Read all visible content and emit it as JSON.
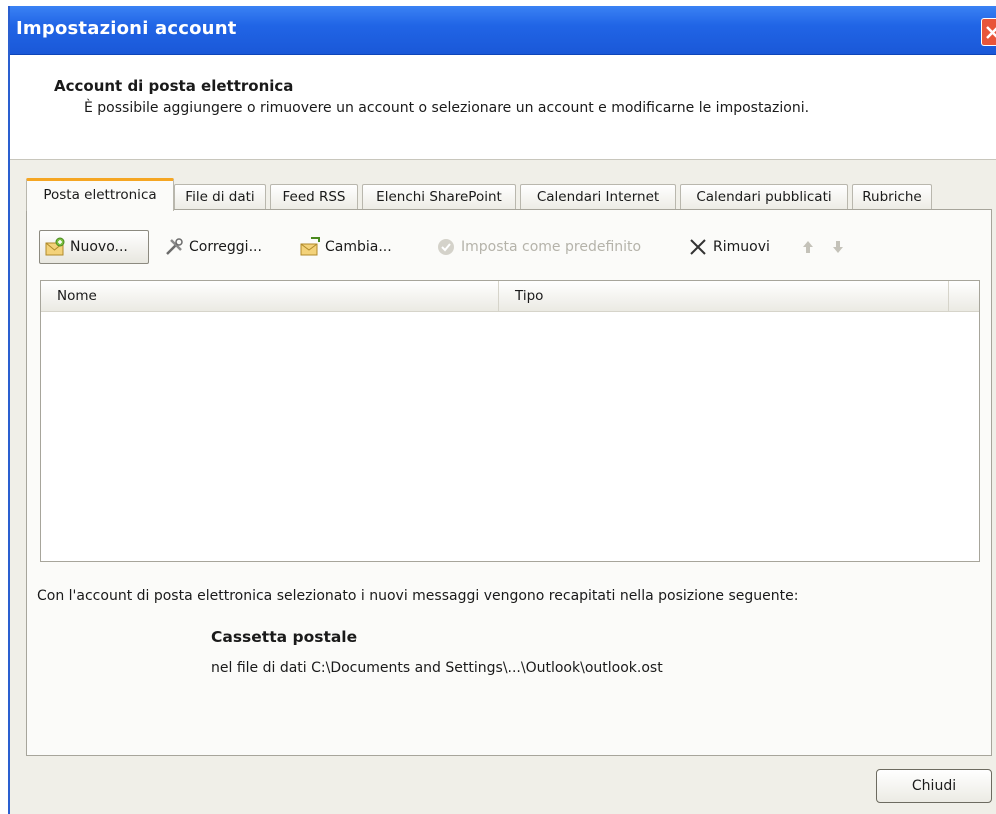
{
  "window": {
    "title": "Impostazioni account"
  },
  "header": {
    "title": "Account di posta elettronica",
    "description": "È possibile aggiungere o rimuovere un account o selezionare un account e modificarne le impostazioni."
  },
  "tabs": [
    {
      "label": "Posta elettronica",
      "active": true
    },
    {
      "label": "File di dati"
    },
    {
      "label": "Feed RSS"
    },
    {
      "label": "Elenchi SharePoint"
    },
    {
      "label": "Calendari Internet"
    },
    {
      "label": "Calendari pubblicati"
    },
    {
      "label": "Rubriche"
    }
  ],
  "toolbar": {
    "new_label": "Nuovo...",
    "repair_label": "Correggi...",
    "change_label": "Cambia...",
    "set_default_label": "Imposta come predefinito",
    "remove_label": "Rimuovi",
    "move_up_icon": "arrow-up-icon",
    "move_down_icon": "arrow-down-icon"
  },
  "account_list": {
    "columns": [
      "Nome",
      "Tipo"
    ],
    "rows": []
  },
  "delivery": {
    "info": "Con l'account di posta elettronica selezionato i nuovi messaggi vengono recapitati nella posizione seguente:",
    "mailbox_name": "Cassetta postale",
    "mailbox_path": "nel file di dati C:\\Documents and Settings\\...\\Outlook\\outlook.ost"
  },
  "footer": {
    "close_label": "Chiudi"
  },
  "colors": {
    "titlebar": "#2165e6",
    "active_tab_accent": "#f5a623",
    "close_button": "#e8553a"
  }
}
